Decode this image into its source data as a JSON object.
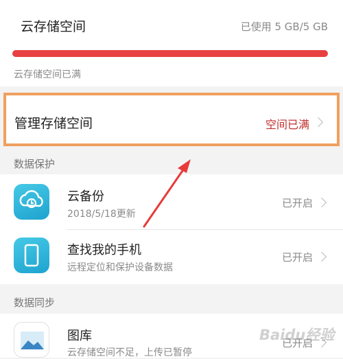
{
  "storage": {
    "title": "云存储空间",
    "usage": "已使用 5 GB/5 GB",
    "used_fraction": 1.0,
    "bar_color": "#e84040",
    "status_text": "云存储空间已满"
  },
  "manage": {
    "label": "管理存储空间",
    "status": "空间已满",
    "status_color": "#c03030",
    "highlight_color": "#f0a060"
  },
  "sections": {
    "backup_header": "数据保护",
    "sync_header": "数据同步"
  },
  "items": [
    {
      "title": "云备份",
      "subtitle": "2018/5/18更新",
      "status": "已开启",
      "icon": "cloud-backup-icon"
    },
    {
      "title": "查找我的手机",
      "subtitle": "远程定位和保护设备数据",
      "status": "已开启",
      "icon": "find-phone-icon"
    },
    {
      "title": "图库",
      "subtitle": "云存储空间不足，上传已暂停",
      "status": "已开启",
      "icon": "gallery-icon"
    }
  ],
  "watermark": "Baidu经验",
  "annotation_arrow_color": "#e83a3a"
}
